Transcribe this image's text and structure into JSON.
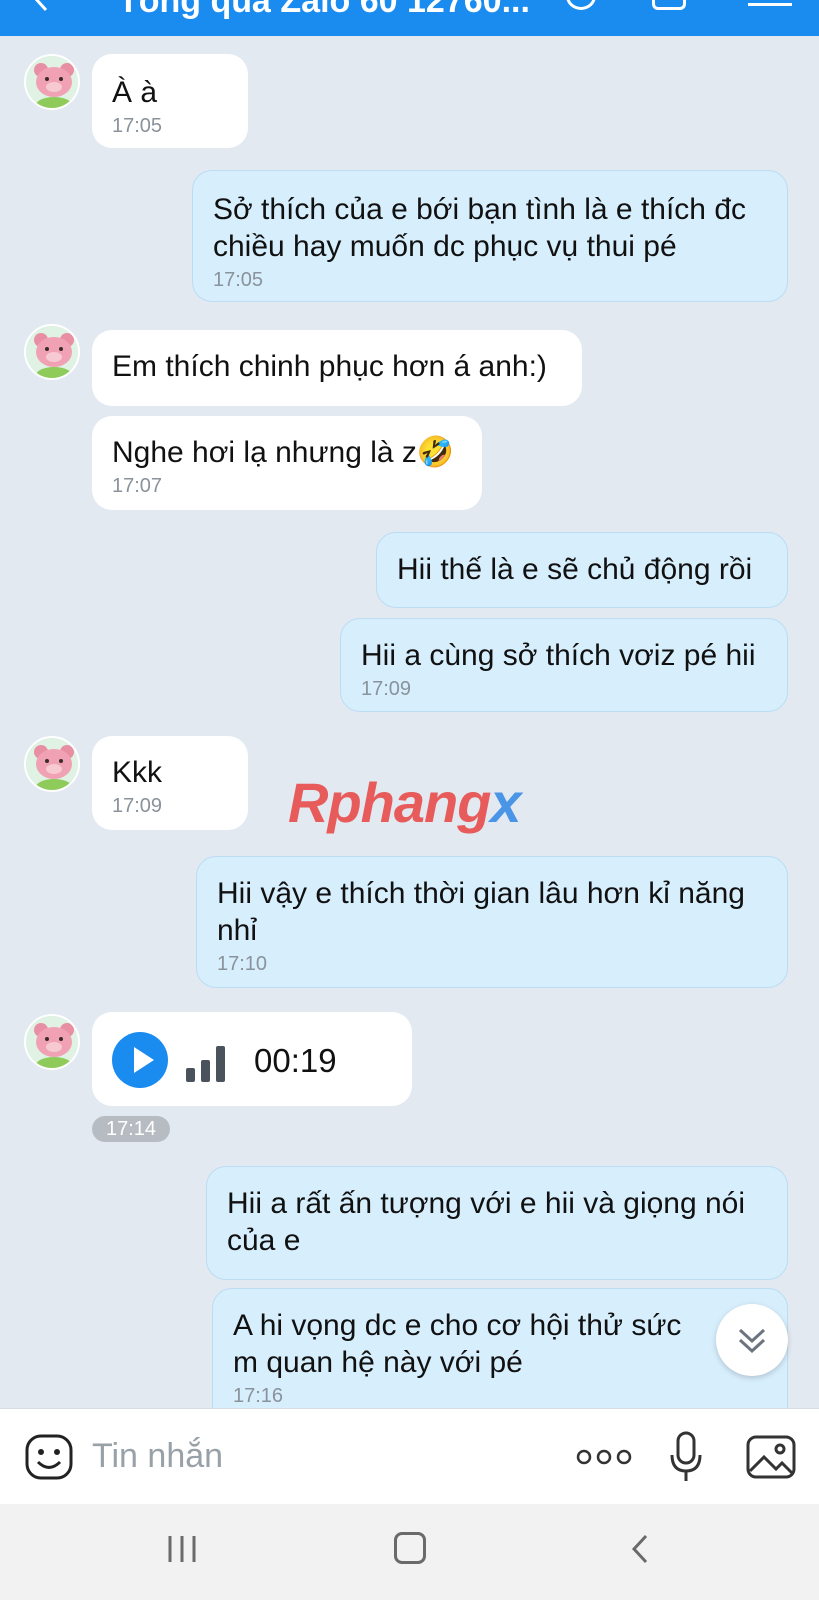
{
  "header": {
    "title_partial": "Tống quà Zalo 60 12760..."
  },
  "messages": [
    {
      "side": "in",
      "text": "À à",
      "time": "17:05"
    },
    {
      "side": "out",
      "text": "Sở thích của e bới bạn tình là e thích đc chiều hay muốn dc phục vụ thui pé",
      "time": "17:05"
    },
    {
      "side": "in",
      "text": "Em thích chinh phục hơn á anh:)",
      "time": ""
    },
    {
      "side": "in",
      "text": "Nghe hơi lạ nhưng là z🤣",
      "time": "17:07"
    },
    {
      "side": "out",
      "text": "Hii thế là e sẽ chủ động rồi",
      "time": ""
    },
    {
      "side": "out",
      "text": "Hii a cùng sở thích vơiz pé hii",
      "time": "17:09"
    },
    {
      "side": "in",
      "text": "Kkk",
      "time": "17:09"
    },
    {
      "side": "out",
      "text": "Hii vậy e thích thời gian lâu hơn kỉ năng nhỉ",
      "time": "17:10"
    },
    {
      "side": "out",
      "text": "Hii a rất ấn tượng với e hii và giọng nói của e",
      "time": ""
    },
    {
      "side": "out",
      "text": "A hi vọng dc e cho cơ hội thử sức m quan hệ này với pé",
      "time": "17:16"
    }
  ],
  "voice_message": {
    "duration": "00:19",
    "time": "17:14"
  },
  "watermark": {
    "part1": "Rphang",
    "part2": "x"
  },
  "input": {
    "placeholder": "Tin nhắn"
  },
  "icons": {
    "emoji": "emoji-icon",
    "more": "more-dots-icon",
    "mic": "microphone-icon",
    "image": "image-icon",
    "play": "play-icon",
    "scroll_down": "double-chevron-down-icon"
  },
  "colors": {
    "accent": "#1a8cf0",
    "chat_background": "#e2e9f1",
    "incoming_bubble": "#ffffff",
    "outgoing_bubble": "#d7eefd"
  }
}
